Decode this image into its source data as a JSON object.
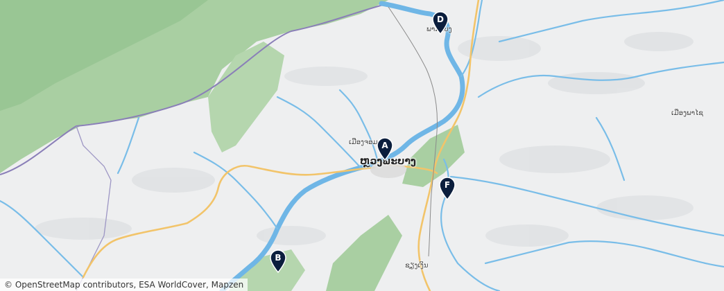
{
  "map": {
    "colors": {
      "land": "#eeeff0",
      "forest": "#b9d7b1",
      "forest_dark": "#8fc28f",
      "water": "#6fb6e6",
      "road": "#f2c46a",
      "border": "#8a7fb8"
    },
    "labels": {
      "luang_prabang": "ຫຼວງພະບາງ",
      "city_near_a": "ເມືອງຈອມ",
      "city_north": "ພາກແບງ",
      "city_east": "ເມືອງພາໄຊ",
      "city_south": "ຊຽງເງິນ"
    },
    "markers": [
      {
        "letter": "A",
        "icon": "map-pin-icon"
      },
      {
        "letter": "B",
        "icon": "map-pin-icon"
      },
      {
        "letter": "D",
        "icon": "map-pin-icon"
      },
      {
        "letter": "F",
        "icon": "map-pin-icon"
      }
    ],
    "attribution": "© OpenStreetMap contributors, ESA WorldCover, Mapzen"
  }
}
